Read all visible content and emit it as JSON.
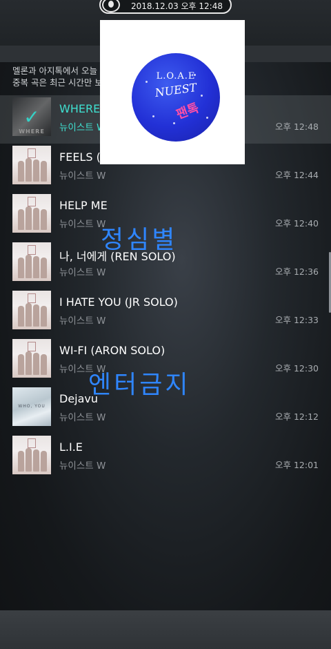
{
  "status": {
    "datetime": "2018.12.03 오후 12:48"
  },
  "notice": {
    "line1": "멜론과 아지톡에서 오늘 (",
    "line2": "중복 곡은 최근 시간만 보"
  },
  "album_popup": {
    "title": "L.O.A.E",
    "brand": "NUEST",
    "tag": "팬톡"
  },
  "watermarks": {
    "top": "정심별",
    "bottom": "엔터금지"
  },
  "tracks": [
    {
      "title": "WHERE",
      "artist": "뉴이스트 W",
      "time": "오후 12:48",
      "thumb_label": "WHERE",
      "playing": true
    },
    {
      "title": "FEELS (",
      "artist": "뉴이스트 W",
      "time": "오후 12:44"
    },
    {
      "title": "HELP ME",
      "artist": "뉴이스트 W",
      "time": "오후 12:40"
    },
    {
      "title": "나, 너에게 (REN SOLO)",
      "artist": "뉴이스트 W",
      "time": "오후 12:36"
    },
    {
      "title": "I HATE YOU (JR SOLO)",
      "artist": "뉴이스트 W",
      "time": "오후 12:33"
    },
    {
      "title": "WI-FI (ARON SOLO)",
      "artist": "뉴이스트 W",
      "time": "오후 12:30"
    },
    {
      "title": "Dejavu",
      "artist": "뉴이스트 W",
      "time": "오후 12:12",
      "thumb_label": "WHO, YOU"
    },
    {
      "title": "L.I.E",
      "artist": "뉴이스트 W",
      "time": "오후 12:01"
    }
  ],
  "icons": {
    "status_disc": "music-disc-icon",
    "playing": "check-icon"
  },
  "colors": {
    "accent": "#3fe0d0",
    "watermark": "#2f86ff"
  }
}
